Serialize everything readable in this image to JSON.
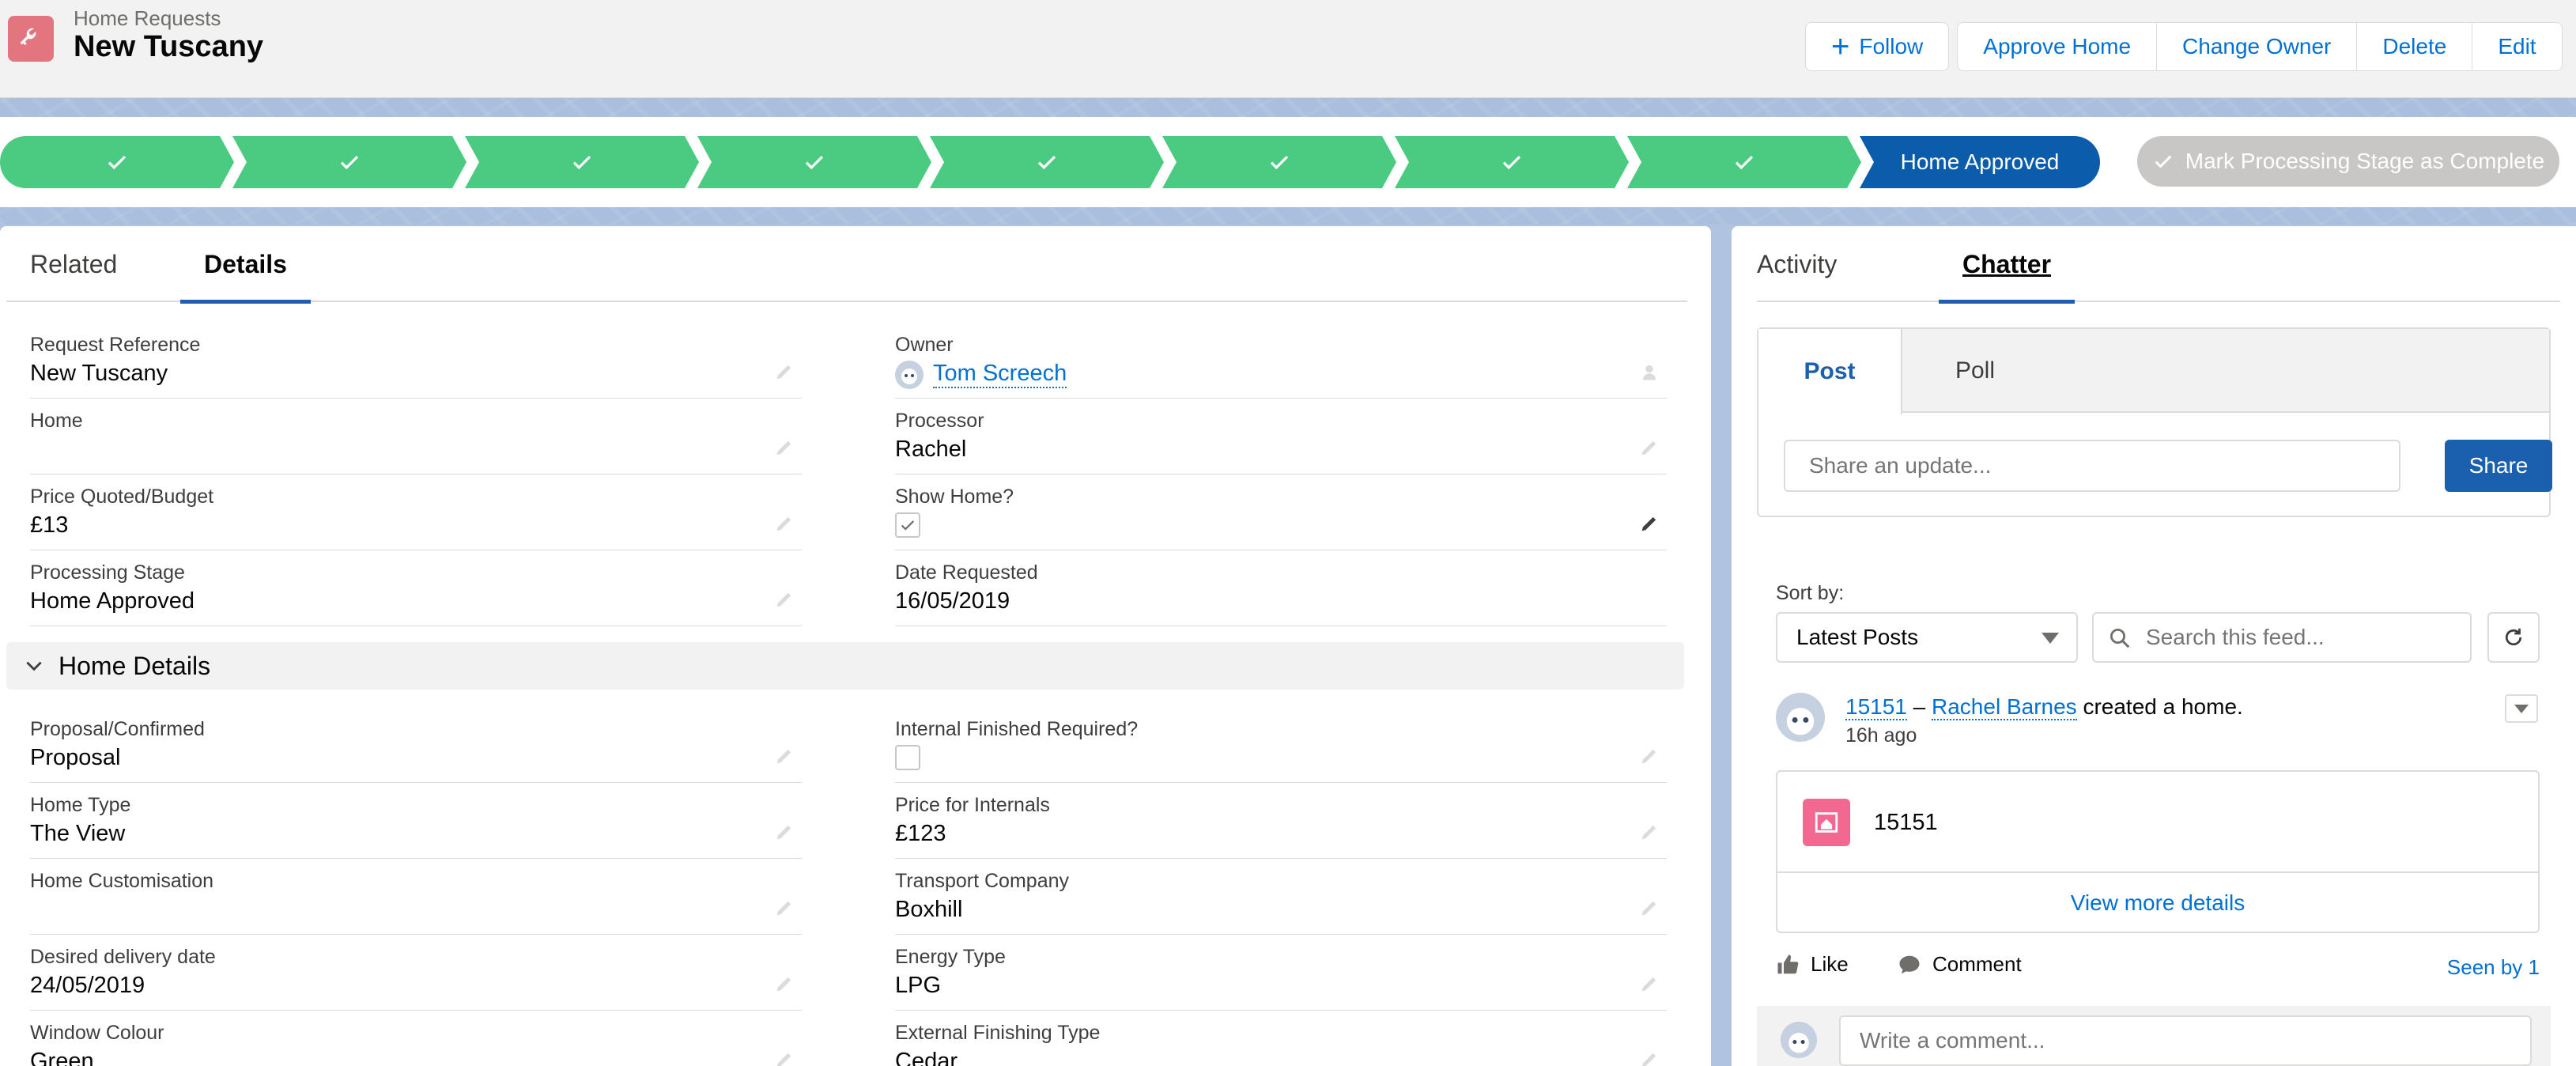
{
  "header": {
    "object_type": "Home Requests",
    "record_title": "New Tuscany",
    "actions": {
      "follow": "Follow",
      "approve": "Approve Home",
      "change_owner": "Change Owner",
      "delete": "Delete",
      "edit": "Edit"
    }
  },
  "path": {
    "completed_stage_count": 8,
    "current_stage": "Home Approved",
    "mark_complete": "Mark Processing Stage as Complete"
  },
  "left_tabs": {
    "related": "Related",
    "details": "Details"
  },
  "fields": {
    "request_reference": {
      "label": "Request Reference",
      "value": "New Tuscany"
    },
    "owner": {
      "label": "Owner",
      "value": "Tom Screech"
    },
    "home": {
      "label": "Home",
      "value": ""
    },
    "processor": {
      "label": "Processor",
      "value": "Rachel"
    },
    "price_quoted": {
      "label": "Price Quoted/Budget",
      "value": "£13"
    },
    "show_home": {
      "label": "Show Home?",
      "checked": true
    },
    "processing_stage": {
      "label": "Processing Stage",
      "value": "Home Approved"
    },
    "date_requested": {
      "label": "Date Requested",
      "value": "16/05/2019"
    }
  },
  "home_details": {
    "title": "Home Details",
    "proposal_confirmed": {
      "label": "Proposal/Confirmed",
      "value": "Proposal"
    },
    "internal_finished": {
      "label": "Internal Finished Required?",
      "checked": false
    },
    "home_type": {
      "label": "Home Type",
      "value": "The View"
    },
    "price_internals": {
      "label": "Price for Internals",
      "value": "£123"
    },
    "home_customisation": {
      "label": "Home Customisation",
      "value": ""
    },
    "transport_company": {
      "label": "Transport Company",
      "value": "Boxhill"
    },
    "desired_delivery": {
      "label": "Desired delivery date",
      "value": "24/05/2019"
    },
    "energy_type": {
      "label": "Energy Type",
      "value": "LPG"
    },
    "window_colour": {
      "label": "Window Colour",
      "value": "Green"
    },
    "external_finishing": {
      "label": "External Finishing Type",
      "value": "Cedar"
    }
  },
  "right_tabs": {
    "activity": "Activity",
    "chatter": "Chatter"
  },
  "publisher": {
    "post_tab": "Post",
    "poll_tab": "Poll",
    "placeholder": "Share an update...",
    "share": "Share"
  },
  "feed": {
    "sort_label": "Sort by:",
    "sort_value": "Latest Posts",
    "search_placeholder": "Search this feed...",
    "item": {
      "record_link": "15151",
      "separator": "–",
      "author": "Rachel Barnes",
      "action": "created a home.",
      "time": "16h ago",
      "attachment_name": "15151",
      "view_more": "View more details",
      "like": "Like",
      "comment": "Comment",
      "seen_by": "Seen by 1",
      "comment_placeholder": "Write a comment..."
    }
  },
  "colors": {
    "path_complete": "#4bca81",
    "path_current": "#0b5cab",
    "brand_blue": "#1b5faf",
    "link": "#0070d2",
    "object_icon": "#e3757f",
    "attachment_icon": "#f26891"
  },
  "icons": {
    "object": "wrench-icon",
    "follow": "plus-icon",
    "stage_done": "check-icon",
    "edit": "pencil-icon",
    "collapse": "chevron-down-icon",
    "search": "search-icon",
    "refresh": "refresh-icon",
    "like": "thumbs-up-icon",
    "comment": "speech-bubble-icon"
  }
}
